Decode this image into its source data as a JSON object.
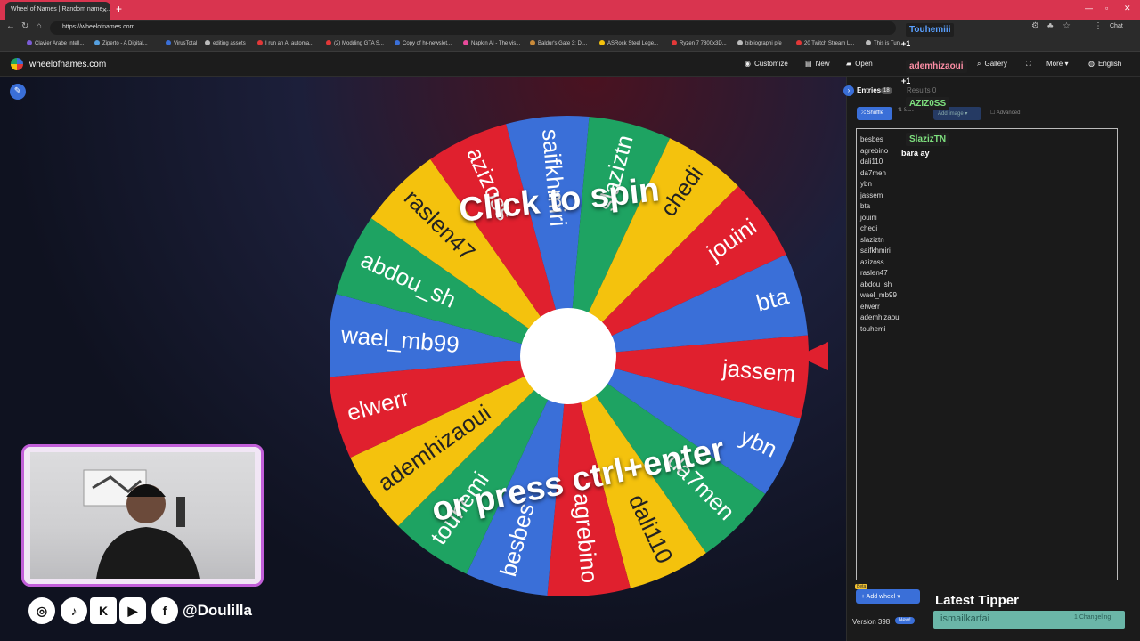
{
  "browser": {
    "tab_title": "Wheel of Names | Random name ...",
    "tab_close": "×",
    "new_tab": "+",
    "url": "https://wheelofnames.com",
    "chat_label": "Chat",
    "bookmarks": [
      {
        "label": "Clavier Arabe Intell...",
        "color": "#7b5cd6"
      },
      {
        "label": "Ziperto - A Digital...",
        "color": "#55a0e0"
      },
      {
        "label": "VirusTotal",
        "color": "#3a6fd8"
      },
      {
        "label": "editing assets",
        "color": "#bbbbbb"
      },
      {
        "label": "I run an AI automa...",
        "color": "#e23838"
      },
      {
        "label": "(2) Modding GTA S...",
        "color": "#e23838"
      },
      {
        "label": "Copy of hr-newslet...",
        "color": "#3a6fd8"
      },
      {
        "label": "Napkin AI - The vis...",
        "color": "#e84a9a"
      },
      {
        "label": "Baldur's Gate 3: Di...",
        "color": "#c98a3a"
      },
      {
        "label": "ASRock Steel Lege...",
        "color": "#f4c20d"
      },
      {
        "label": "Ryzen 7 7800x3D...",
        "color": "#e23838"
      },
      {
        "label": "bibliographi pfe",
        "color": "#bbbbbb"
      },
      {
        "label": "20 Twitch Stream L...",
        "color": "#e23838"
      },
      {
        "label": "This is Tun...",
        "color": "#bbbbbb"
      }
    ]
  },
  "app": {
    "site_name": "wheelofnames.com",
    "nav": {
      "customize": "Customize",
      "new": "New",
      "open": "Open",
      "gallery": "Gallery",
      "more": "More",
      "language": "English"
    },
    "wheel": {
      "slice_colors": [
        "#e0202e",
        "#3a6fd8",
        "#1ea362",
        "#f4c20d"
      ],
      "entries_on_wheel": [
        "jassem",
        "ybn",
        "da7men",
        "dali110",
        "agrebino",
        "besbes",
        "touhemi",
        "ademhizaoui",
        "elwerr",
        "wael_mb99",
        "abdou_sh",
        "raslen47",
        "azizoss",
        "saifkhmiri",
        "slaziztn",
        "chedi",
        "jouini",
        "bta"
      ],
      "overlay_top": "Click to spin",
      "overlay_bottom": "or press ctrl+enter"
    },
    "panel": {
      "entries_tab": "Entries",
      "entries_count": "18",
      "results_tab": "Results",
      "results_count": "0",
      "shuffle": "Shuffle",
      "sort": "Sort",
      "add_image": "Add image",
      "advanced": "Advanced",
      "entries": [
        "besbes",
        "agrebino",
        "dali110",
        "da7men",
        "ybn",
        "jassem",
        "bta",
        "jouini",
        "chedi",
        "slaziztn",
        "saifkhmiri",
        "azizoss",
        "raslen47",
        "abdou_sh",
        "wael_mb99",
        "elwerr",
        "ademhizaoui",
        "touhemi"
      ],
      "add_wheel": "Add wheel",
      "beta": "Beta",
      "version": "Version 398",
      "new_badge": "New!"
    }
  },
  "chat_overlay": {
    "names": [
      {
        "name": "Touhemiii",
        "color": "#5aa0ff"
      },
      {
        "name": "ademhizaoui",
        "color": "#ff8fa6"
      },
      {
        "name": "AZIZ0SS",
        "color": "#7ee07e"
      },
      {
        "name": "SlazizTN",
        "color": "#7ee07e"
      }
    ],
    "plus_one": "+1",
    "message": "bara ay"
  },
  "tipper": {
    "title": "Latest Tipper",
    "name": "ismailkarfai",
    "side": "1 Changeling"
  },
  "stream": {
    "handle": "@Doulilla",
    "social_icons": [
      "instagram-icon",
      "tiktok-icon",
      "kick-icon",
      "youtube-icon",
      "facebook-icon"
    ]
  }
}
